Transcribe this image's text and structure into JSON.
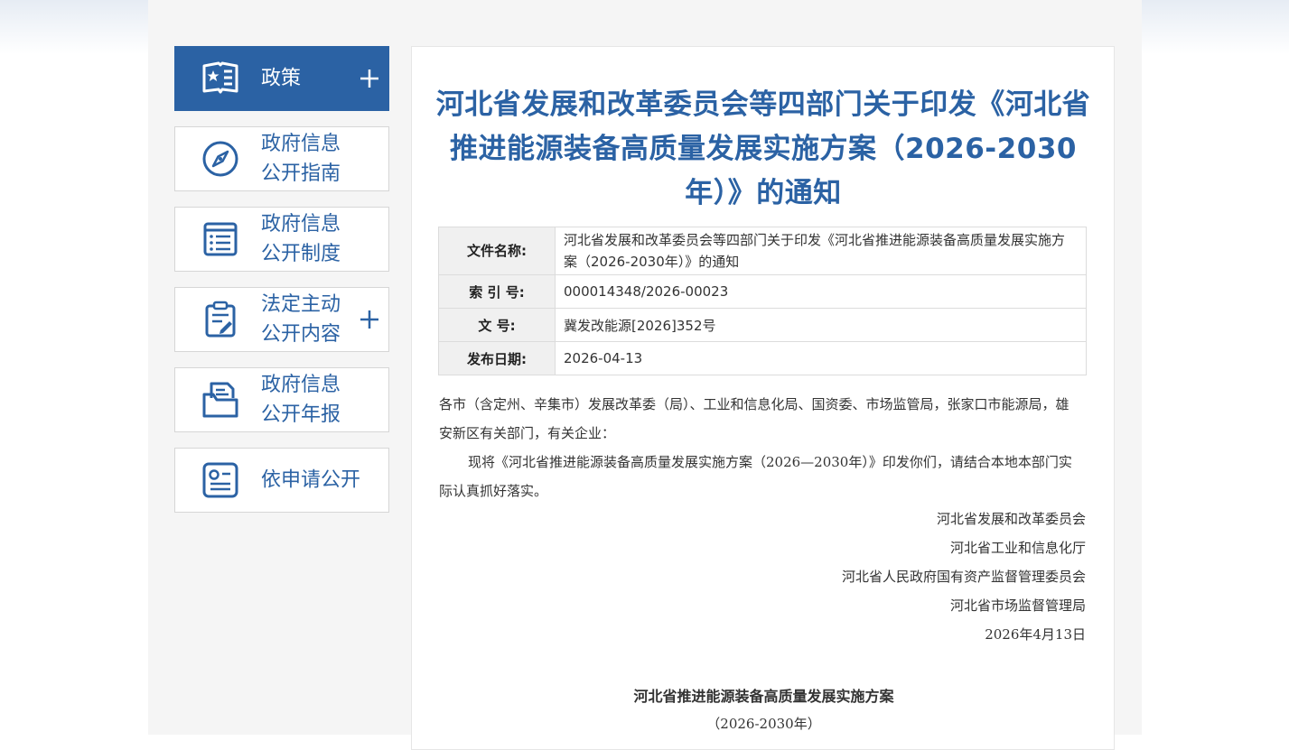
{
  "sidebar": {
    "items": [
      {
        "label": "政策",
        "icon": "policy-book-icon",
        "expandable": true
      },
      {
        "label": "政府信息\n公开指南",
        "icon": "compass-icon",
        "expandable": false
      },
      {
        "label": "政府信息\n公开制度",
        "icon": "list-document-icon",
        "expandable": false
      },
      {
        "label": "法定主动\n公开内容",
        "icon": "clipboard-edit-icon",
        "expandable": true
      },
      {
        "label": "政府信息\n公开年报",
        "icon": "folder-document-icon",
        "expandable": false
      },
      {
        "label": "依申请公开",
        "icon": "id-card-icon",
        "expandable": false
      }
    ]
  },
  "article": {
    "title": "河北省发展和改革委员会等四部门关于印发《河北省推进能源装备高质量发展实施方案（2026-2030年）》的通知",
    "meta": [
      {
        "key": "文件名称:",
        "value": "河北省发展和改革委员会等四部门关于印发《河北省推进能源装备高质量发展实施方案（2026-2030年）》的通知"
      },
      {
        "key": "索 引 号:",
        "value": "000014348/2026-00023"
      },
      {
        "key": "文 号:",
        "value": "冀发改能源[2026]352号"
      },
      {
        "key": "发布日期:",
        "value": "2026-04-13"
      }
    ],
    "para1": "各市（含定州、辛集市）发展改革委（局）、工业和信息化局、国资委、市场监管局，张家口市能源局，雄安新区有关部门，有关企业：",
    "para2": "现将《河北省推进能源装备高质量发展实施方案（2026—2030年）》印发你们，请结合本地本部门实际认真抓好落实。",
    "signatures": [
      "河北省发展和改革委员会",
      "河北省工业和信息化厅",
      "河北省人民政府国有资产监督管理委员会",
      "河北省市场监督管理局"
    ],
    "date": "2026年4月13日",
    "plan_title": "河北省推进能源装备高质量发展实施方案",
    "plan_subtitle": "（2026-2030年）"
  },
  "colors": {
    "accent": "#2b62a4",
    "page_bg": "#f5f5f5",
    "border": "#d6d6d6"
  }
}
